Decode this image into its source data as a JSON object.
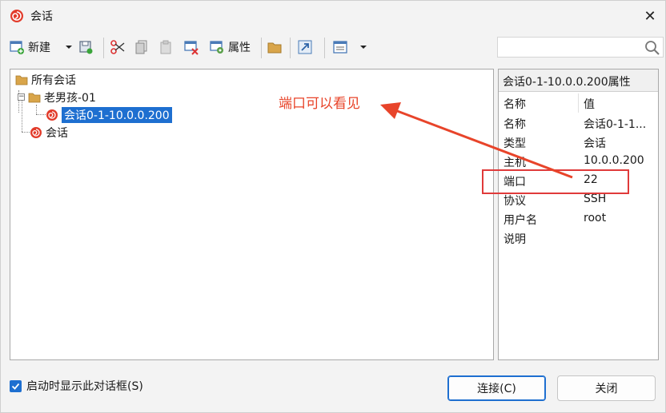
{
  "window": {
    "title": "会话"
  },
  "toolbar": {
    "new_label": "新建",
    "properties_label": "属性",
    "search": {
      "value": "",
      "placeholder": ""
    }
  },
  "tree": {
    "root": "所有会话",
    "group": "老男孩-01",
    "selected_session": "会话0-1-10.0.0.200",
    "session": "会话"
  },
  "properties": {
    "title": "会话0-1-10.0.0.200属性",
    "header_key": "名称",
    "header_value": "值",
    "rows": [
      {
        "key": "名称",
        "value": "会话0-1-1..."
      },
      {
        "key": "类型",
        "value": "会话"
      },
      {
        "key": "主机",
        "value": "10.0.0.200"
      },
      {
        "key": "端口",
        "value": "22"
      },
      {
        "key": "协议",
        "value": "SSH"
      },
      {
        "key": "用户名",
        "value": "root"
      },
      {
        "key": "说明",
        "value": ""
      }
    ]
  },
  "annotation": {
    "text": "端口可以看见",
    "color": "#e8442a"
  },
  "footer": {
    "show_on_start": "启动时显示此对话框(S)",
    "connect": "连接(C)",
    "close": "关闭"
  },
  "colors": {
    "accent": "#1e6fd0",
    "highlight": "#e03a3a"
  }
}
